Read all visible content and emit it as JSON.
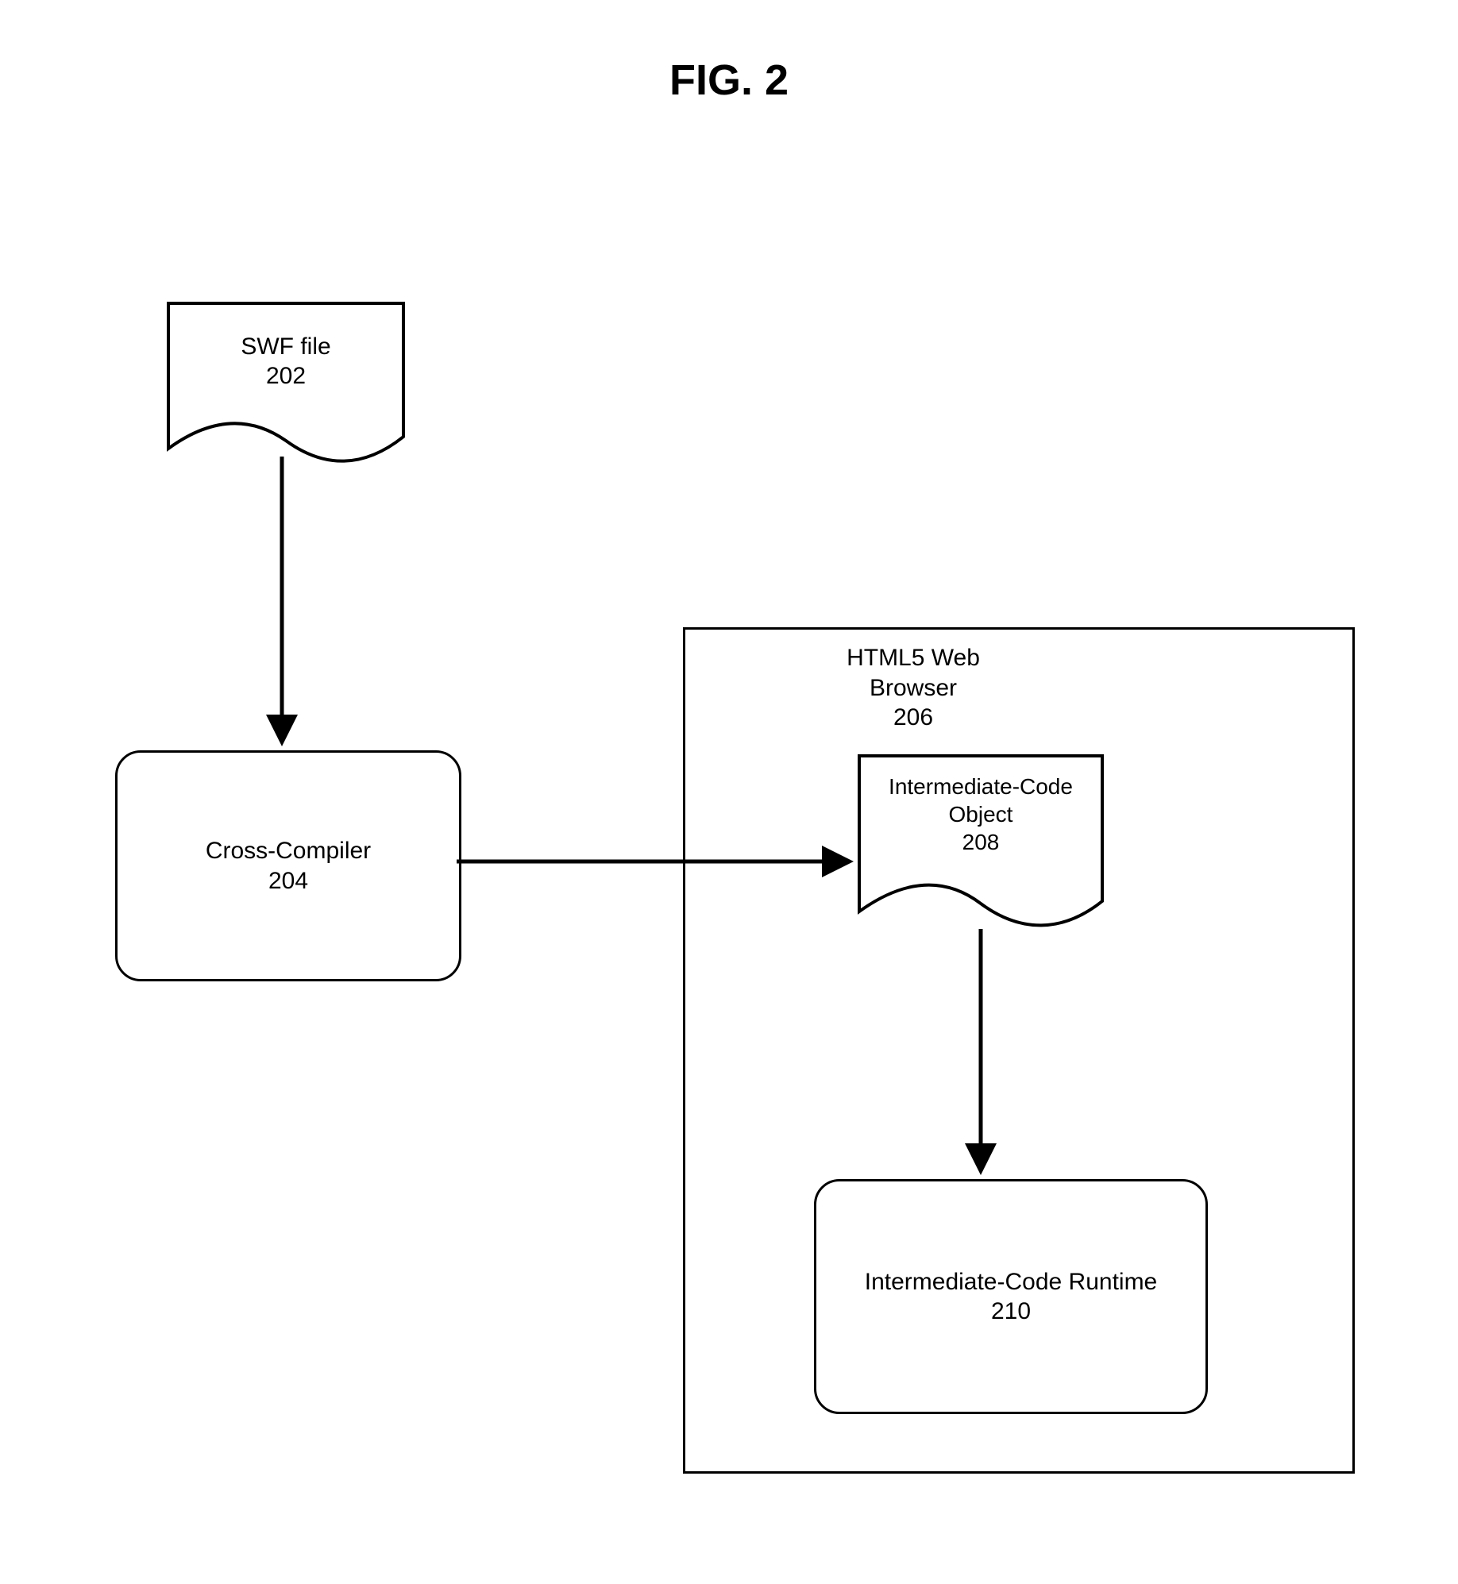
{
  "figure_title": "FIG. 2",
  "nodes": {
    "swf_file": {
      "label_line1": "SWF file",
      "label_line2": "202"
    },
    "cross_compiler": {
      "label_line1": "Cross-Compiler",
      "label_line2": "204"
    },
    "browser_container": {
      "label_line1": "HTML5 Web",
      "label_line2": "Browser",
      "label_line3": "206"
    },
    "intermediate_object": {
      "label_line1": "Intermediate-Code",
      "label_line2": "Object",
      "label_line3": "208"
    },
    "intermediate_runtime": {
      "label_line1": "Intermediate-Code Runtime",
      "label_line2": "210"
    }
  }
}
